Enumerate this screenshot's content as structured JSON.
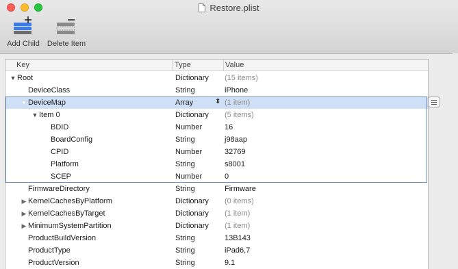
{
  "window": {
    "title": "Restore.plist"
  },
  "toolbar": {
    "add_child_label": "Add Child",
    "delete_item_label": "Delete Item"
  },
  "columns": {
    "key": "Key",
    "type": "Type",
    "value": "Value"
  },
  "rows": [
    {
      "key": "Root",
      "type": "Dictionary",
      "value": "(15 items)",
      "toggle": "down"
    },
    {
      "key": "DeviceClass",
      "type": "String",
      "value": "iPhone"
    },
    {
      "key": "DeviceMap",
      "type": "Array",
      "value": "(1 item)",
      "toggle": "down",
      "selected": true
    },
    {
      "key": "Item 0",
      "type": "Dictionary",
      "value": "(5 items)",
      "toggle": "down"
    },
    {
      "key": "BDID",
      "type": "Number",
      "value": "16"
    },
    {
      "key": "BoardConfig",
      "type": "String",
      "value": "j98aap"
    },
    {
      "key": "CPID",
      "type": "Number",
      "value": "32769"
    },
    {
      "key": "Platform",
      "type": "String",
      "value": "s8001"
    },
    {
      "key": "SCEP",
      "type": "Number",
      "value": "0"
    },
    {
      "key": "FirmwareDirectory",
      "type": "String",
      "value": "Firmware"
    },
    {
      "key": "KernelCachesByPlatform",
      "type": "Dictionary",
      "value": "(0 items)",
      "toggle": "right"
    },
    {
      "key": "KernelCachesByTarget",
      "type": "Dictionary",
      "value": "(1 item)",
      "toggle": "right"
    },
    {
      "key": "MinimumSystemPartition",
      "type": "Dictionary",
      "value": "(1 item)",
      "toggle": "right"
    },
    {
      "key": "ProductBuildVersion",
      "type": "String",
      "value": "13B143"
    },
    {
      "key": "ProductType",
      "type": "String",
      "value": "iPad6,7"
    },
    {
      "key": "ProductVersion",
      "type": "String",
      "value": "9.1"
    }
  ],
  "colors": {
    "selection": "#cfe0f6",
    "selection_border": "#6b8fbd",
    "muted_value": "#8a8a8a"
  }
}
